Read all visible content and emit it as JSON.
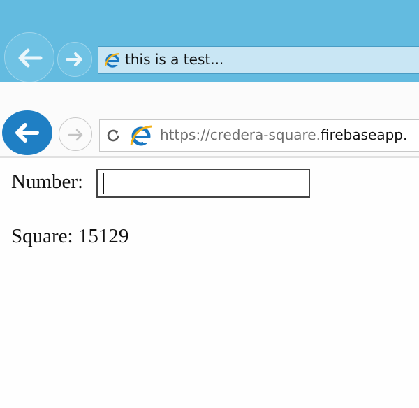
{
  "outer_browser": {
    "tab_title": "this is a test...",
    "back_icon": "back-arrow-icon",
    "forward_icon": "forward-arrow-icon",
    "page_icon": "internet-explorer-icon"
  },
  "inner_browser": {
    "url_prefix": "https://credera-square.",
    "url_domain": "firebaseapp.",
    "back_icon": "back-arrow-icon",
    "forward_icon": "forward-arrow-icon",
    "refresh_icon": "refresh-icon",
    "page_icon": "internet-explorer-icon"
  },
  "form": {
    "number_label": "Number:",
    "number_value": "",
    "square_text": "Square: 15129"
  },
  "colors": {
    "outer_chrome": "#63bbe0",
    "inner_back_button": "#1f7fc4"
  }
}
